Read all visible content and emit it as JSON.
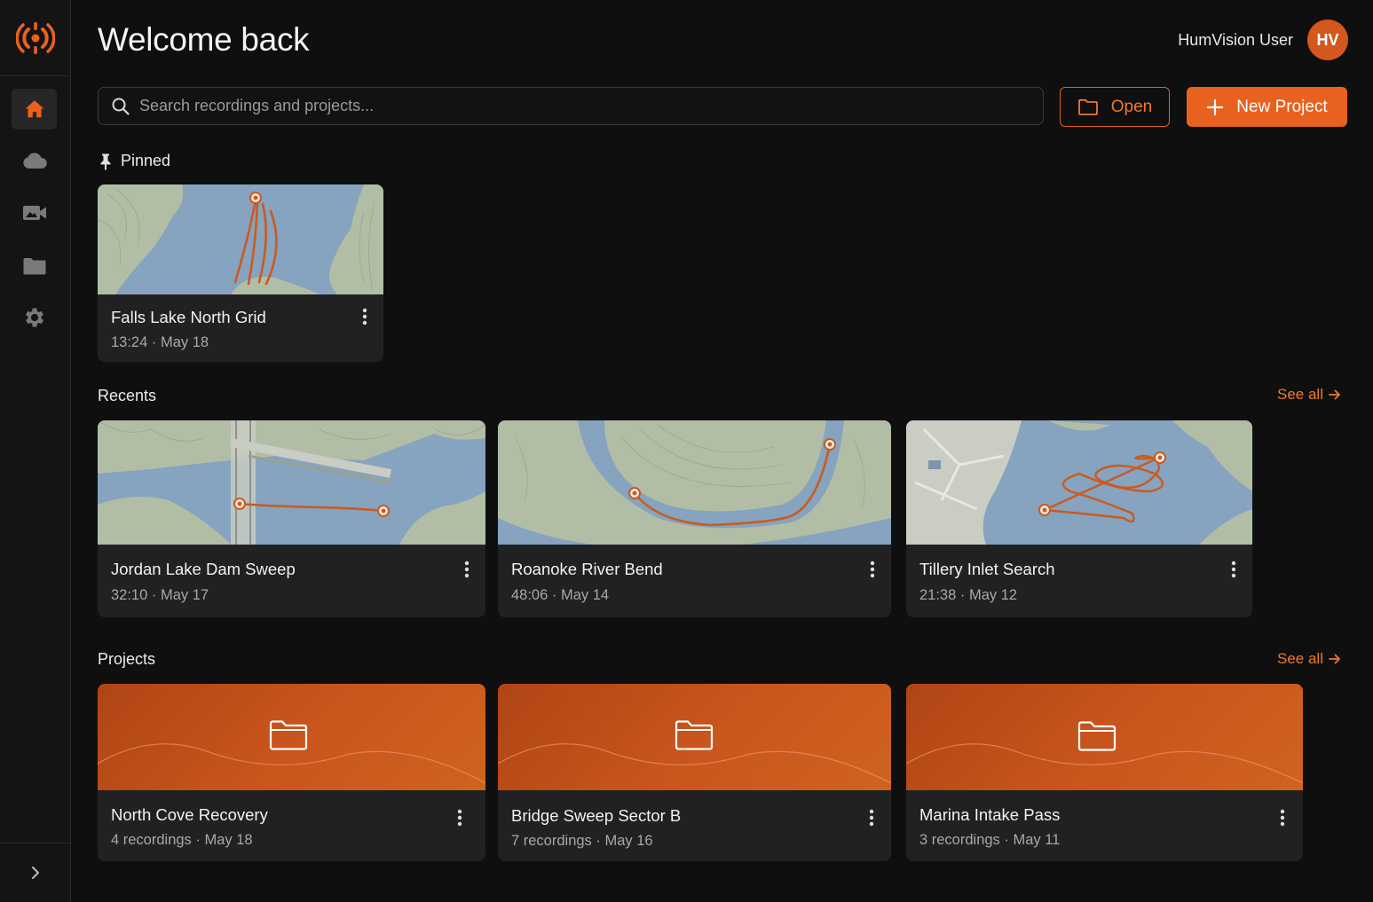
{
  "app": {
    "logo_icon": "humvision-logo",
    "accent_color": "#e8621f"
  },
  "sidebar": {
    "items": [
      {
        "name": "home",
        "icon": "home-icon",
        "active": true
      },
      {
        "name": "cloud",
        "icon": "cloud-icon",
        "active": false
      },
      {
        "name": "recordings",
        "icon": "video-camera-icon",
        "active": false
      },
      {
        "name": "projects",
        "icon": "folder-icon",
        "active": false
      },
      {
        "name": "settings",
        "icon": "gear-icon",
        "active": false
      }
    ],
    "collapse_icon": "chevron-right-icon"
  },
  "header": {
    "title": "Welcome back",
    "user_name": "HumVision User",
    "avatar_initials": "HV"
  },
  "search": {
    "placeholder": "Search recordings and projects..."
  },
  "toolbar": {
    "open_label": "Open",
    "new_project_label": "New Project"
  },
  "pinned": {
    "title": "Pinned",
    "items": [
      {
        "name": "Falls Lake North Grid",
        "meta": "13:24 · May 18"
      }
    ]
  },
  "recents": {
    "title": "Recents",
    "see_all": "See all",
    "items": [
      {
        "name": "Jordan Lake Dam Sweep",
        "meta": "32:10 · May 17"
      },
      {
        "name": "Roanoke River Bend",
        "meta": "48:06 · May 14"
      },
      {
        "name": "Tillery Inlet Search",
        "meta": "21:38 · May 12"
      }
    ]
  },
  "projects": {
    "title": "Projects",
    "see_all": "See all",
    "items": [
      {
        "name": "North Cove Recovery",
        "meta": "4 recordings · May 18"
      },
      {
        "name": "Bridge Sweep Sector B",
        "meta": "7 recordings · May 16"
      },
      {
        "name": "Marina Intake Pass",
        "meta": "3 recordings · May 11"
      }
    ]
  }
}
